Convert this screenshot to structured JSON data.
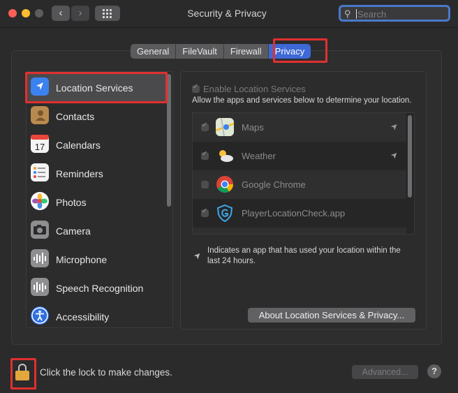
{
  "window": {
    "title": "Security & Privacy"
  },
  "search": {
    "placeholder": "Search"
  },
  "tabs": [
    {
      "label": "General"
    },
    {
      "label": "FileVault"
    },
    {
      "label": "Firewall"
    },
    {
      "label": "Privacy",
      "active": true
    }
  ],
  "sidebar": {
    "items": [
      {
        "label": "Location Services",
        "icon": "location-arrow-icon",
        "selected": true
      },
      {
        "label": "Contacts",
        "icon": "contacts-book-icon"
      },
      {
        "label": "Calendars",
        "icon": "calendar-icon"
      },
      {
        "label": "Reminders",
        "icon": "reminders-list-icon"
      },
      {
        "label": "Photos",
        "icon": "photos-flower-icon"
      },
      {
        "label": "Camera",
        "icon": "camera-icon"
      },
      {
        "label": "Microphone",
        "icon": "waveform-icon"
      },
      {
        "label": "Speech Recognition",
        "icon": "waveform-icon"
      },
      {
        "label": "Accessibility",
        "icon": "accessibility-icon"
      }
    ]
  },
  "location": {
    "enable_label": "Enable Location Services",
    "allow_text": "Allow the apps and services below to determine your location.",
    "apps": [
      {
        "name": "Maps",
        "checked": true,
        "recent": true,
        "icon": "maps-icon"
      },
      {
        "name": "Weather",
        "checked": true,
        "recent": true,
        "icon": "weather-icon"
      },
      {
        "name": "Google Chrome",
        "checked": false,
        "recent": false,
        "icon": "chrome-icon"
      },
      {
        "name": "PlayerLocationCheck.app",
        "checked": true,
        "recent": false,
        "icon": "shield-g-icon"
      }
    ],
    "note": "Indicates an app that has used your location within the last 24 hours.",
    "about_button": "About Location Services & Privacy..."
  },
  "footer": {
    "lock_text": "Click the lock to make changes.",
    "advanced_button": "Advanced...",
    "help": "?"
  },
  "colors": {
    "accent": "#3d68d6",
    "highlight": "#e1302f",
    "lock": "#e3a73b"
  }
}
